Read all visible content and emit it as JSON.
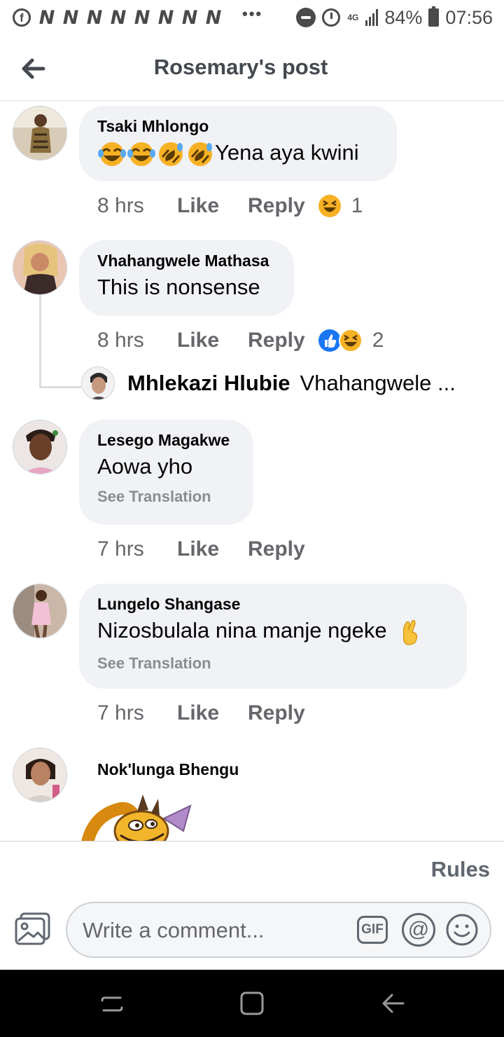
{
  "status_bar": {
    "notif_glyphs": [
      "N",
      "N",
      "N",
      "N",
      "N",
      "N",
      "N",
      "N"
    ],
    "more": "•••",
    "network": "4G",
    "battery": "84%",
    "time": "07:56",
    "icons": [
      "facebook-icon",
      "do-not-disturb-icon",
      "alarm-icon",
      "signal-icon",
      "battery-icon"
    ]
  },
  "header": {
    "title": "Rosemary's post",
    "back_icon": "back-arrow-icon"
  },
  "comments": [
    {
      "author": "Tsaki Mhlongo",
      "text": "Yena aya kwini",
      "leading_emojis": [
        "joy",
        "joy",
        "rofl",
        "rofl"
      ],
      "time": "8 hrs",
      "like": "Like",
      "reply": "Reply",
      "reactions": [
        "haha"
      ],
      "reaction_count": "1"
    },
    {
      "author": "Vhahangwele Mathasa",
      "text": "This is nonsense",
      "time": "8 hrs",
      "like": "Like",
      "reply": "Reply",
      "reactions": [
        "like",
        "haha"
      ],
      "reaction_count": "2",
      "reply_preview": {
        "author": "Mhlekazi Hlubie",
        "text": "Vhahangwele ..."
      }
    },
    {
      "author": "Lesego Magakwe",
      "text": "Aowa yho",
      "see_translation": "See Translation",
      "time": "7 hrs",
      "like": "Like",
      "reply": "Reply"
    },
    {
      "author": "Lungelo Shangase",
      "text": "Nizosbulala nina manje ngeke",
      "trailing_emoji": "crossed-fingers",
      "see_translation": "See Translation",
      "time": "7 hrs",
      "like": "Like",
      "reply": "Reply"
    },
    {
      "author": "Nok'lunga Bhengu",
      "sticker": "dragon-sticker"
    }
  ],
  "bottom": {
    "rules": "Rules",
    "composer_placeholder": "Write a comment...",
    "gif_label": "GIF",
    "mention_label": "@"
  },
  "colors": {
    "bubble": "#f0f2f5",
    "secondary_text": "#65676b",
    "like_blue": "#1877f2",
    "haha_yellow": "#f7b125"
  }
}
